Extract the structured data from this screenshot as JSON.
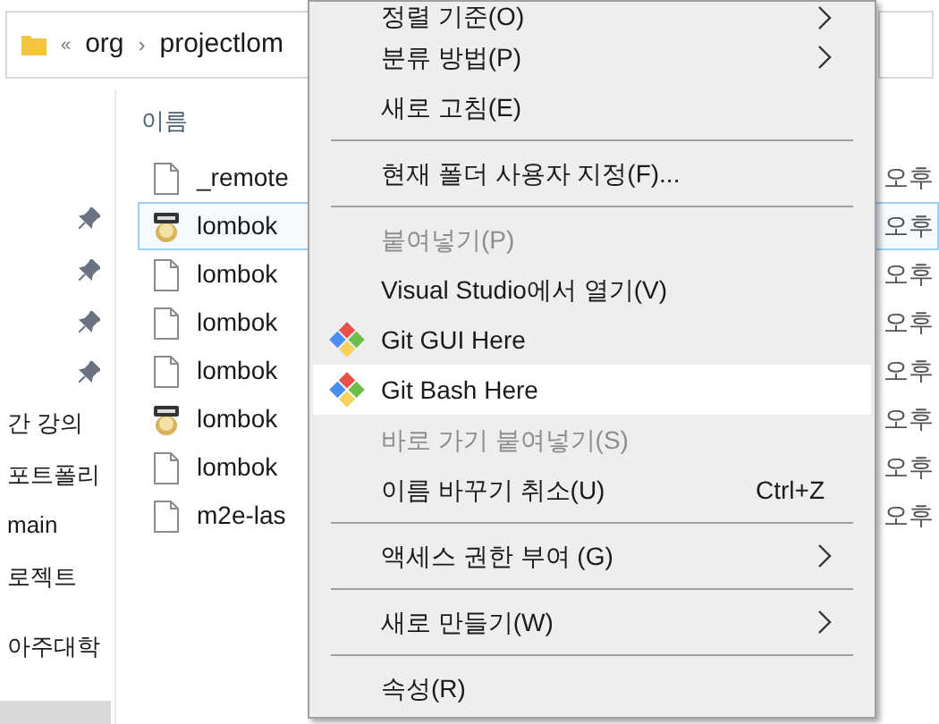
{
  "address_bar": {
    "crumbs": [
      {
        "kind": "overflow",
        "label": "«"
      },
      {
        "kind": "folder",
        "label": "org"
      },
      {
        "kind": "separator",
        "label": "›"
      },
      {
        "kind": "folder",
        "label": "projectlom"
      }
    ]
  },
  "nav_pane": {
    "items": [
      {
        "label": "간 강의",
        "selected": false
      },
      {
        "label": "포트폴리",
        "selected": false
      },
      {
        "label": "main",
        "selected": false
      },
      {
        "label": "로젝트",
        "selected": false
      },
      {
        "label": "아주대학",
        "selected": false
      },
      {
        "selected": true
      }
    ]
  },
  "file_list": {
    "column_1": "이름",
    "rows": [
      {
        "name": "_remote",
        "kind": "doc",
        "selected": false,
        "time": "오후"
      },
      {
        "name": "lombok",
        "kind": "jar",
        "selected": true,
        "time": "오후"
      },
      {
        "name": "lombok",
        "kind": "doc",
        "selected": false,
        "time": "오후"
      },
      {
        "name": "lombok",
        "kind": "doc",
        "selected": false,
        "time": "오후"
      },
      {
        "name": "lombok",
        "kind": "doc",
        "selected": false,
        "time": "오후"
      },
      {
        "name": "lombok",
        "kind": "jar",
        "selected": false,
        "time": "오후"
      },
      {
        "name": "lombok",
        "kind": "doc",
        "selected": false,
        "time": "오후"
      },
      {
        "name": "m2e-las",
        "kind": "doc",
        "selected": false,
        "time": "오후"
      }
    ]
  },
  "context_menu": {
    "items": [
      {
        "kind": "item",
        "label": "정렬 기준(O)",
        "disabled": false,
        "submenu": true,
        "selected": false
      },
      {
        "kind": "item",
        "label": "분류 방법(P)",
        "disabled": false,
        "submenu": true,
        "selected": false
      },
      {
        "kind": "item",
        "label": "새로 고침(E)",
        "disabled": false,
        "submenu": false,
        "selected": false
      },
      {
        "kind": "separator"
      },
      {
        "kind": "item",
        "label": "현재 폴더 사용자 지정(F)...",
        "disabled": false,
        "submenu": false,
        "selected": false
      },
      {
        "kind": "separator"
      },
      {
        "kind": "item",
        "label": "붙여넣기(P)",
        "disabled": true,
        "submenu": false,
        "selected": false
      },
      {
        "kind": "item",
        "label": "Visual Studio에서 열기(V)",
        "disabled": false,
        "submenu": false,
        "selected": false
      },
      {
        "kind": "git",
        "label": "Git GUI Here",
        "disabled": false,
        "submenu": false,
        "selected": false
      },
      {
        "kind": "git",
        "label": "Git Bash Here",
        "disabled": false,
        "submenu": false,
        "selected": true
      },
      {
        "kind": "item",
        "label": "바로 가기 붙여넣기(S)",
        "disabled": true,
        "submenu": false,
        "selected": false
      },
      {
        "kind": "item",
        "label": "이름 바꾸기 취소(U)",
        "shortcut": "Ctrl+Z",
        "disabled": false,
        "submenu": false,
        "selected": false
      },
      {
        "kind": "separator"
      },
      {
        "kind": "item",
        "label": "액세스 권한 부여 (G)",
        "disabled": false,
        "submenu": true,
        "selected": false
      },
      {
        "kind": "separator"
      },
      {
        "kind": "item",
        "label": "새로 만들기(W)",
        "disabled": false,
        "submenu": true,
        "selected": false
      },
      {
        "kind": "separator"
      },
      {
        "kind": "item",
        "label": "속성(R)",
        "disabled": false,
        "submenu": false,
        "selected": false
      }
    ]
  }
}
